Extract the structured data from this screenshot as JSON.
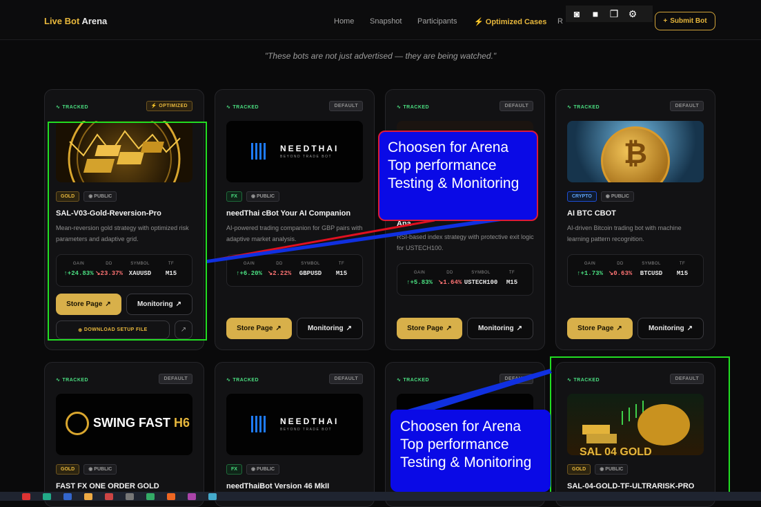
{
  "nav": {
    "logo_a": "Live Bot",
    "logo_b": "Arena",
    "items": [
      "Home",
      "Snapshot",
      "Participants"
    ],
    "optimized": "Optimized Cases",
    "cut": "R",
    "submit": "Submit Bot"
  },
  "quote": "\"These bots are not just advertised — they are being watched.\"",
  "tracked": "TRACKED",
  "stat_labels": [
    "GAIN",
    "DD",
    "SYMBOL",
    "TF"
  ],
  "buttons": {
    "store": "Store Page",
    "monitoring": "Monitoring",
    "download": "DOWNLOAD SETUP FILE"
  },
  "cards": [
    {
      "tag": "OPTIMIZED",
      "cat": "GOLD",
      "pub": "PUBLIC",
      "name": "SAL-V03-Gold-Reversion-Pro",
      "desc": "Mean-reversion gold strategy with optimized risk parameters and adaptive grid.",
      "gain": "+24.83%",
      "dd": "23.37%",
      "symbol": "XAUUSD",
      "tf": "M15"
    },
    {
      "tag": "DEFAULT",
      "cat": "FX",
      "pub": "PUBLIC",
      "name": "needThai cBot Your AI Companion",
      "desc": "AI-powered trading companion for GBP pairs with adaptive market analysis.",
      "gain": "+6.20%",
      "dd": "2.22%",
      "symbol": "GBPUSD",
      "tf": "M15",
      "logo": "NEEDTHAI",
      "sub": "BEYOND TRADE BOT"
    },
    {
      "tag": "DEFAULT",
      "name_partial": "Ana",
      "desc": "RSI-based index strategy with protective exit logic for USTECH100.",
      "gain": "+5.83%",
      "dd": "1.64%",
      "symbol": "USTECH100",
      "tf": "M15"
    },
    {
      "tag": "DEFAULT",
      "cat": "CRYPTO",
      "pub": "PUBLIC",
      "name": "AI BTC CBOT",
      "desc": "AI-driven Bitcoin trading bot with machine learning pattern recognition.",
      "gain": "+1.73%",
      "dd": "0.63%",
      "symbol": "BTCUSD",
      "tf": "M15"
    },
    {
      "tag": "DEFAULT",
      "cat": "GOLD",
      "pub": "PUBLIC",
      "name": "FAST FX ONE ORDER GOLD",
      "logo": "SWING FAST",
      "logo2": "H6"
    },
    {
      "tag": "DEFAULT",
      "cat": "FX",
      "pub": "PUBLIC",
      "name": "needThaiBot Version 46 MkII",
      "logo": "NEEDTHAI",
      "sub": "BEYOND TRADE BOT"
    },
    {
      "tag": "DEFAULT"
    },
    {
      "tag": "DEFAULT",
      "cat": "GOLD",
      "pub": "PUBLIC",
      "name": "SAL-04-GOLD-TF-ULTRARISK-PRO",
      "img_text": "SAL 04 GOLD"
    }
  ],
  "callout": "Choosen for Arena Top performance Testing & Monitoring"
}
